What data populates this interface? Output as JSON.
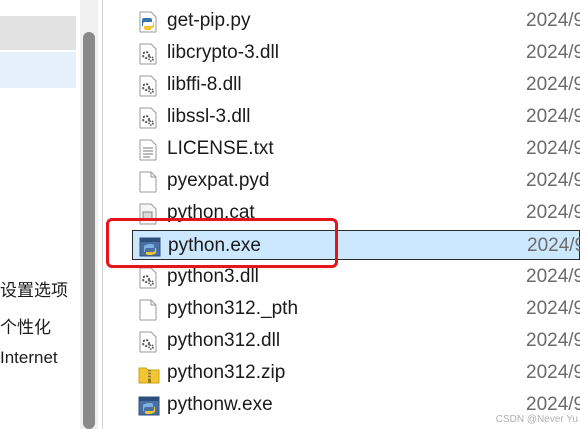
{
  "nav": {
    "labels": [
      "设置选项",
      "个性化",
      "Internet"
    ]
  },
  "files": [
    {
      "name": "get-pip.py",
      "date": "2024/9",
      "icon": "python-script-icon"
    },
    {
      "name": "libcrypto-3.dll",
      "date": "2024/9",
      "icon": "dll-gear-icon"
    },
    {
      "name": "libffi-8.dll",
      "date": "2024/9",
      "icon": "dll-gear-icon"
    },
    {
      "name": "libssl-3.dll",
      "date": "2024/9",
      "icon": "dll-gear-icon"
    },
    {
      "name": "LICENSE.txt",
      "date": "2024/9",
      "icon": "text-file-icon"
    },
    {
      "name": "pyexpat.pyd",
      "date": "2024/9",
      "icon": "blank-file-icon"
    },
    {
      "name": "python.cat",
      "date": "2024/9",
      "icon": "catalog-file-icon"
    },
    {
      "name": "python.exe",
      "date": "2024/9",
      "icon": "python-exe-icon",
      "selected": true
    },
    {
      "name": "python3.dll",
      "date": "2024/9",
      "icon": "dll-gear-icon"
    },
    {
      "name": "python312._pth",
      "date": "2024/9",
      "icon": "blank-file-icon"
    },
    {
      "name": "python312.dll",
      "date": "2024/9",
      "icon": "dll-gear-icon"
    },
    {
      "name": "python312.zip",
      "date": "2024/9",
      "icon": "zip-folder-icon"
    },
    {
      "name": "pythonw.exe",
      "date": "2024/9",
      "icon": "python-exe-icon"
    }
  ],
  "watermark": "CSDN @Never Yu",
  "colors": {
    "selection_fill": "#cce8ff",
    "annotation_red": "#e8141b",
    "python_blue": "#3a74a8",
    "python_yellow": "#f2c531"
  }
}
